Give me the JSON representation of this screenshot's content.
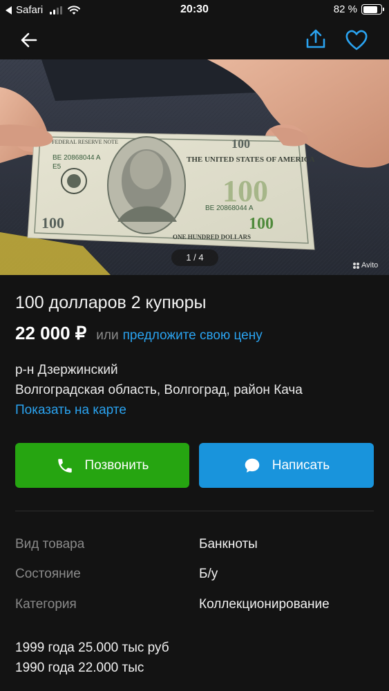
{
  "status_bar": {
    "app": "Safari",
    "time": "20:30",
    "battery": "82 %",
    "battery_level": 0.82
  },
  "nav": {
    "back_icon": "arrow-left-icon",
    "share_icon": "share-icon",
    "favorite_icon": "heart-icon",
    "accent_color": "#2aa3f0"
  },
  "photo": {
    "counter": "1 / 4",
    "watermark": "Avito",
    "banknote_text": {
      "serial": "BE 20868044 A",
      "serial_left": "BE 20868044 A",
      "block": "E5",
      "header": "FEDERAL RESERVE NOTE",
      "country": "THE UNITED STATES OF AMERICA",
      "denomination": "100",
      "denomination_words": "ONE HUNDRED DOLLARS"
    }
  },
  "listing": {
    "title": "100 долларов 2 купюры",
    "price": "22 000 ₽",
    "price_or": "или",
    "price_offer": "предложите свою цену",
    "district": "р-н Дзержинский",
    "address": "Волгоградская область, Волгоград, район Кача",
    "map_link": "Показать на карте"
  },
  "actions": {
    "call_label": "Позвонить",
    "call_icon": "phone-icon",
    "call_color": "#26a511",
    "write_label": "Написать",
    "write_icon": "chat-bubble-icon",
    "write_color": "#1994dc"
  },
  "params": [
    {
      "label": "Вид товара",
      "value": "Банкноты"
    },
    {
      "label": "Состояние",
      "value": "Б/у"
    },
    {
      "label": "Категория",
      "value": "Коллекционирование"
    }
  ],
  "description": [
    "1999 года 25.000 тыс руб",
    "1990 года 22.000 тыс"
  ]
}
